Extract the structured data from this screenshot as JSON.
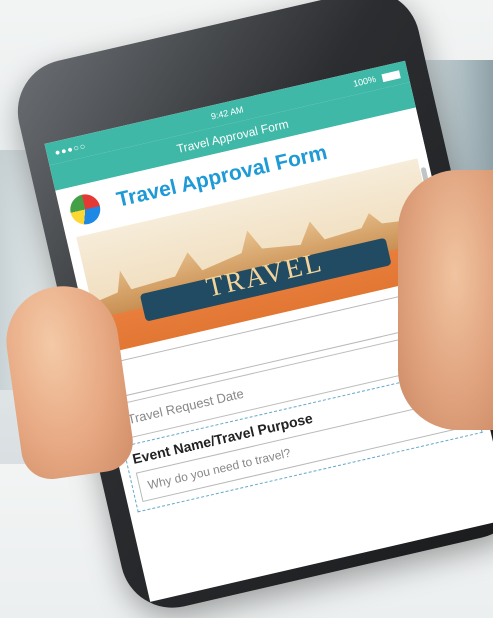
{
  "status": {
    "carrier": "●●●○○",
    "time": "9:42 AM",
    "battery": "100%"
  },
  "nav": {
    "title": "Travel Approval Form"
  },
  "form": {
    "title": "Travel Approval Form",
    "banner_text": "TRAVEL",
    "date_placeholder": "Travel Request Date",
    "event_label": "Event Name/Travel Purpose",
    "purpose_placeholder": "Why do you need to travel?"
  },
  "icons": {
    "calendar": "calendar-icon",
    "copy": "copy-icon",
    "delete": "trash-icon",
    "logo": "globe-logo-icon"
  },
  "colors": {
    "accent": "#3fb8a7",
    "title": "#1e9ad6",
    "banner_orange": "#e27734"
  }
}
